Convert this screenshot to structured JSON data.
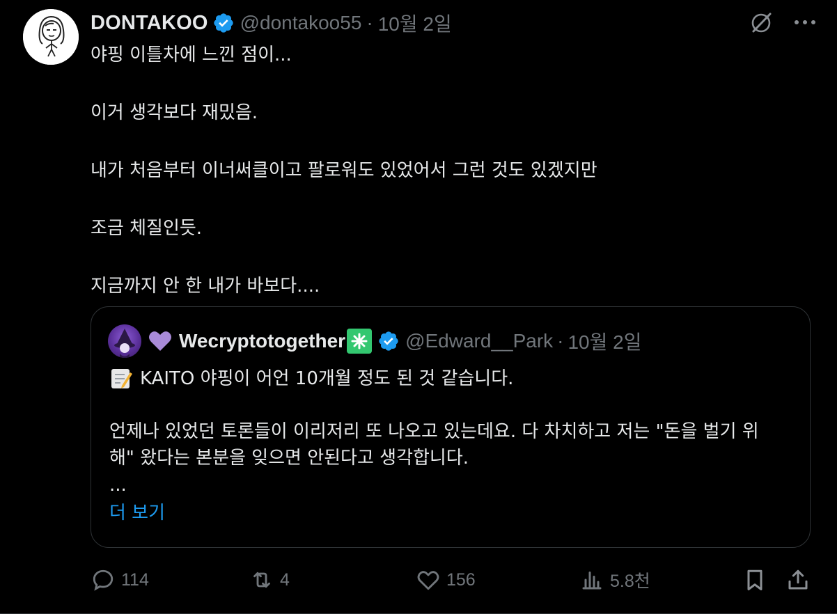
{
  "tweet": {
    "display_name": "DONTAKOO",
    "handle": "@dontakoo55",
    "separator": "·",
    "time": "10월 2일",
    "lines": [
      "야핑 이틀차에 느낀 점이...",
      "이거 생각보다 재밌음.",
      "내가 처음부터 이너써클이고 팔로워도 있었어서 그런 것도 있겠지만",
      "조금 체질인듯.",
      "지금까지 안 한 내가 바보다...."
    ]
  },
  "quote": {
    "display_name": "Wecryptotogether",
    "handle": "@Edward__Park",
    "separator": "·",
    "time": "10월 2일",
    "line1": "KAITO 야핑이 어언 10개월 정도 된 것 같습니다.",
    "line2": "언제나 있었던 토론들이 이리저리 또 나오고 있는데요. 다 차치하고 저는 \"돈을 벌기 위",
    "line3": "해\" 왔다는 본분을 잊으면 안된다고 생각합니다.",
    "ellipsis": "...",
    "show_more": "더 보기"
  },
  "actions": {
    "replies": "114",
    "reposts": "4",
    "likes": "156",
    "views": "5.8천"
  },
  "colors": {
    "background": "#000000",
    "text": "#e7e9ea",
    "muted": "#71767b",
    "accent": "#1d9bf0",
    "border": "#2f3336"
  },
  "icons": [
    "verified-badge-icon",
    "grok-icon",
    "more-icon",
    "purple-heart-icon",
    "sparkle-icon",
    "memo-icon",
    "reply-icon",
    "repost-icon",
    "like-icon",
    "views-icon",
    "bookmark-icon",
    "share-icon"
  ]
}
